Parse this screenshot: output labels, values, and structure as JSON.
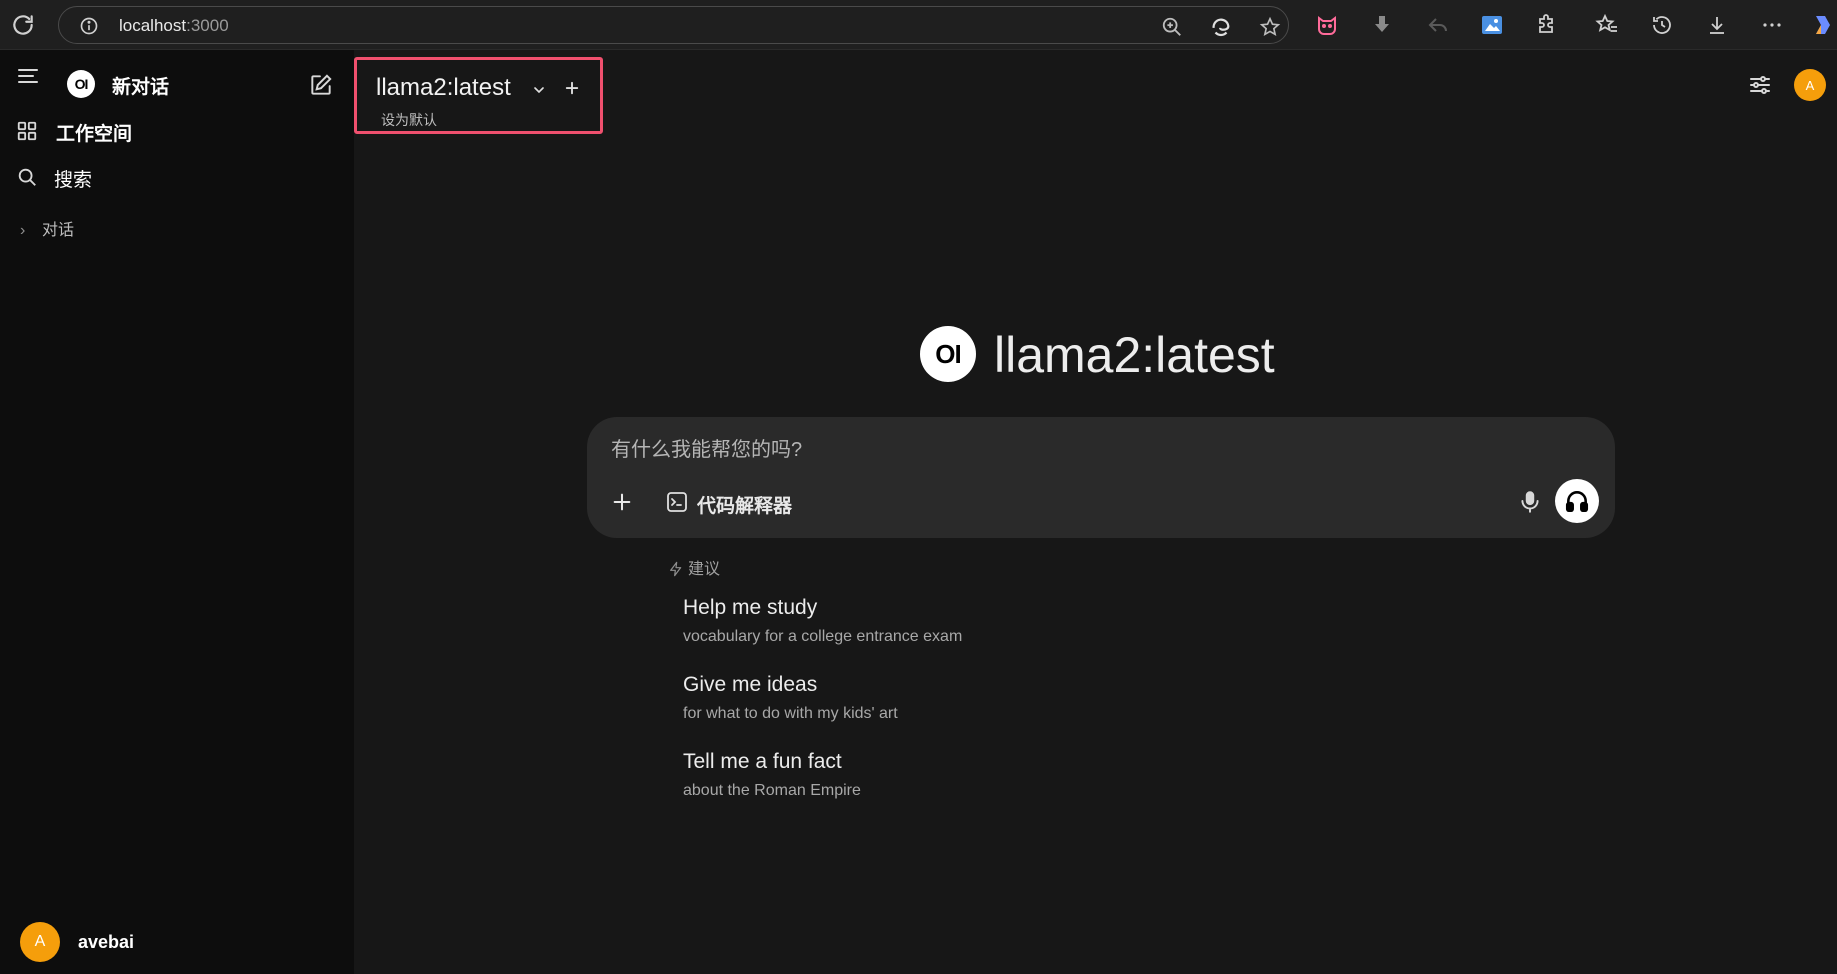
{
  "browser": {
    "url_host": "localhost",
    "url_port": ":3000"
  },
  "sidebar": {
    "logo_text": "OI",
    "new_chat_label": "新对话",
    "items": [
      {
        "label": "工作空间",
        "icon": "grid-icon"
      },
      {
        "label": "搜索",
        "icon": "search-icon"
      }
    ],
    "chats_label": "对话",
    "user": {
      "avatar_letter": "A",
      "name": "avebai"
    }
  },
  "header": {
    "model_name": "llama2:latest",
    "set_default_label": "设为默认",
    "avatar_letter": "A"
  },
  "main": {
    "logo_text": "OI",
    "hero_title": "llama2:latest",
    "composer": {
      "placeholder": "有什么我能帮您的吗?",
      "code_interpreter_label": "代码解释器"
    },
    "suggestions_label": "建议",
    "suggestions": [
      {
        "title": "Help me study",
        "subtitle": "vocabulary for a college entrance exam"
      },
      {
        "title": "Give me ideas",
        "subtitle": "for what to do with my kids' art"
      },
      {
        "title": "Tell me a fun fact",
        "subtitle": "about the Roman Empire"
      }
    ]
  },
  "colors": {
    "accent_avatar": "#f59e0b",
    "highlight_border": "#f0506e"
  }
}
